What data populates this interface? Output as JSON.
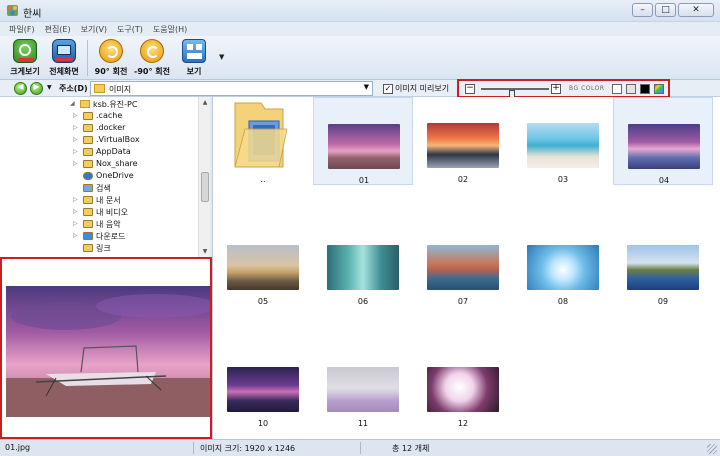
{
  "window": {
    "title": "한씨"
  },
  "menu": [
    {
      "label": "파일(F)"
    },
    {
      "label": "편집(E)"
    },
    {
      "label": "보기(V)"
    },
    {
      "label": "도구(T)"
    },
    {
      "label": "도움말(H)"
    }
  ],
  "toolbar": {
    "buttons": [
      {
        "label": "크게보기",
        "icon": "zoom-view-icon"
      },
      {
        "label": "전체화면",
        "icon": "fullscreen-icon"
      },
      {
        "label": "90° 회전",
        "icon": "rotate-cw-icon"
      },
      {
        "label": "-90° 회전",
        "icon": "rotate-ccw-icon"
      },
      {
        "label": "보기",
        "icon": "view-icon"
      }
    ]
  },
  "address": {
    "label": "주소(D)",
    "value": "이미지",
    "preview_checkbox_label": "이미지 미리보기",
    "bg_color_label": "BG COLOR",
    "slider_level": 0.45
  },
  "tree": {
    "root": "ksb.유진-PC",
    "items": [
      {
        "label": ".cache",
        "type": "folder"
      },
      {
        "label": ".docker",
        "type": "folder"
      },
      {
        "label": ".VirtualBox",
        "type": "folder"
      },
      {
        "label": "AppData",
        "type": "folder"
      },
      {
        "label": "Nox_share",
        "type": "folder"
      },
      {
        "label": "OneDrive",
        "type": "cloud"
      },
      {
        "label": "검색",
        "type": "search"
      },
      {
        "label": "내 문서",
        "type": "folder"
      },
      {
        "label": "내 비디오",
        "type": "video"
      },
      {
        "label": "내 음악",
        "type": "music"
      },
      {
        "label": "다운로드",
        "type": "download"
      },
      {
        "label": "링크",
        "type": "link"
      }
    ]
  },
  "thumbs": [
    {
      "caption": "..",
      "kind": "folder"
    },
    {
      "caption": "01",
      "selected": true
    },
    {
      "caption": "02"
    },
    {
      "caption": "03"
    },
    {
      "caption": "04",
      "selected": true
    },
    {
      "caption": "05"
    },
    {
      "caption": "06"
    },
    {
      "caption": "07"
    },
    {
      "caption": "08"
    },
    {
      "caption": "09"
    },
    {
      "caption": "10"
    },
    {
      "caption": "11"
    },
    {
      "caption": "12"
    }
  ],
  "status": {
    "filename": "01.jpg",
    "image_size": "이미지 크기: 1920 x 1246",
    "count": "총 12 개체"
  }
}
